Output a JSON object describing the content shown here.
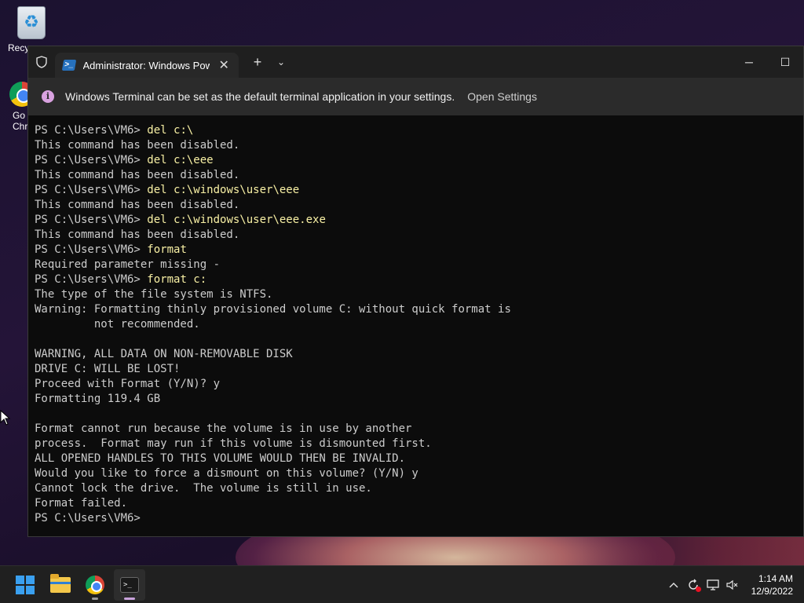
{
  "desktop": {
    "icons": [
      {
        "label": "Recy",
        "icon": "recycle-bin-icon"
      },
      {
        "label": "Go\nChr",
        "icon": "chrome-icon"
      }
    ]
  },
  "terminal": {
    "tab_title": "Administrator: Windows Powe",
    "new_tab_symbol": "+",
    "dropdown_symbol": "⌄",
    "close_tab_symbol": "✕",
    "minimize_symbol": "─",
    "maximize_symbol": "☐",
    "infobar": {
      "message": "Windows Terminal can be set as the default terminal application in your settings.",
      "link": "Open Settings"
    },
    "lines": [
      {
        "prompt": "PS C:\\Users\\VM6> ",
        "cmd": "del c:\\"
      },
      {
        "text": "This command has been disabled."
      },
      {
        "prompt": "PS C:\\Users\\VM6> ",
        "cmd": "del c:\\eee"
      },
      {
        "text": "This command has been disabled."
      },
      {
        "prompt": "PS C:\\Users\\VM6> ",
        "cmd": "del c:\\windows\\user\\eee"
      },
      {
        "text": "This command has been disabled."
      },
      {
        "prompt": "PS C:\\Users\\VM6> ",
        "cmd": "del c:\\windows\\user\\eee.exe"
      },
      {
        "text": "This command has been disabled."
      },
      {
        "prompt": "PS C:\\Users\\VM6> ",
        "cmd": "format"
      },
      {
        "text": "Required parameter missing -"
      },
      {
        "prompt": "PS C:\\Users\\VM6> ",
        "cmd": "format c:"
      },
      {
        "text": "The type of the file system is NTFS."
      },
      {
        "text": "Warning: Formatting thinly provisioned volume C: without quick format is"
      },
      {
        "text": "         not recommended."
      },
      {
        "text": ""
      },
      {
        "text": "WARNING, ALL DATA ON NON-REMOVABLE DISK"
      },
      {
        "text": "DRIVE C: WILL BE LOST!"
      },
      {
        "text": "Proceed with Format (Y/N)? y"
      },
      {
        "text": "Formatting 119.4 GB"
      },
      {
        "text": ""
      },
      {
        "text": "Format cannot run because the volume is in use by another"
      },
      {
        "text": "process.  Format may run if this volume is dismounted first."
      },
      {
        "text": "ALL OPENED HANDLES TO THIS VOLUME WOULD THEN BE INVALID."
      },
      {
        "text": "Would you like to force a dismount on this volume? (Y/N) y"
      },
      {
        "text": "Cannot lock the drive.  The volume is still in use."
      },
      {
        "text": "Format failed."
      },
      {
        "prompt": "PS C:\\Users\\VM6>",
        "cmd": ""
      }
    ]
  },
  "taskbar": {
    "apps": [
      "start-icon",
      "file-explorer-icon",
      "chrome-icon",
      "terminal-icon"
    ],
    "tray": {
      "chevron": "^",
      "time": "1:14 AM",
      "date": "12/9/2022"
    }
  }
}
